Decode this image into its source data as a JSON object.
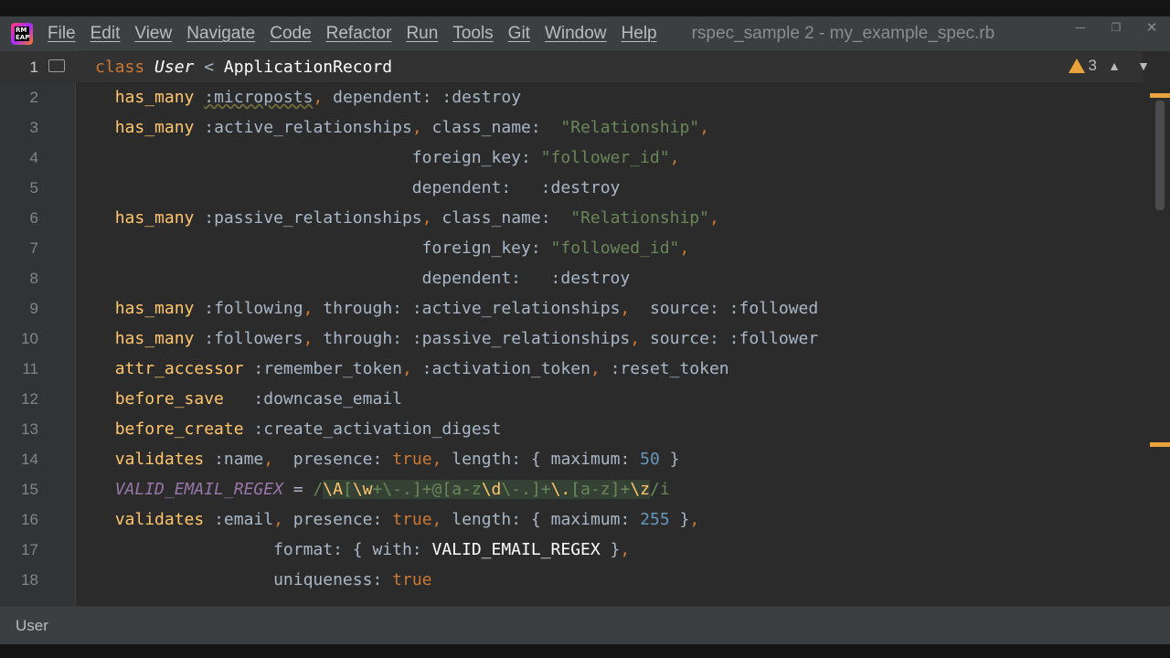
{
  "app": {
    "logo_text": "RM\nEAP",
    "window_title": "rspec_sample 2 - my_example_spec.rb"
  },
  "menu": [
    "File",
    "Edit",
    "View",
    "Navigate",
    "Code",
    "Refactor",
    "Run",
    "Tools",
    "Git",
    "Window",
    "Help"
  ],
  "editor": {
    "warnings_count": "3",
    "lines": [
      {
        "n": "1"
      },
      {
        "n": "2"
      },
      {
        "n": "3"
      },
      {
        "n": "4"
      },
      {
        "n": "5"
      },
      {
        "n": "6"
      },
      {
        "n": "7"
      },
      {
        "n": "8"
      },
      {
        "n": "9"
      },
      {
        "n": "10"
      },
      {
        "n": "11"
      },
      {
        "n": "12"
      },
      {
        "n": "13"
      },
      {
        "n": "14"
      },
      {
        "n": "15"
      },
      {
        "n": "16"
      },
      {
        "n": "17"
      },
      {
        "n": "18"
      }
    ],
    "tokens": {
      "class_kw": "class",
      "class_name": "User",
      "superclass": "ApplicationRecord",
      "has_many": "has_many",
      "microposts": ":microposts",
      "dependent": "dependent:",
      "destroy": ":destroy",
      "active_rel": ":active_relationships",
      "passive_rel": ":passive_relationships",
      "class_name_key": "class_name:",
      "relationship": "\"Relationship\"",
      "foreign_key": "foreign_key:",
      "follower_id": "\"follower_id\"",
      "followed_id": "\"followed_id\"",
      "following": ":following",
      "followers": ":followers",
      "through": "through:",
      "source": "source:",
      "followed": ":followed",
      "follower": ":follower",
      "attr_accessor": "attr_accessor",
      "remember_token": ":remember_token",
      "activation_token": ":activation_token",
      "reset_token": ":reset_token",
      "before_save": "before_save",
      "downcase_email": ":downcase_email",
      "before_create": "before_create",
      "create_activation_digest": ":create_activation_digest",
      "validates": "validates",
      "name_sym": ":name",
      "presence": "presence:",
      "true": "true",
      "length": "length:",
      "maximum": "maximum:",
      "n50": "50",
      "n255": "255",
      "valid_email": "VALID_EMAIL_REGEX",
      "email_sym": ":email",
      "format": "format:",
      "with": "with:",
      "uniqueness": "uniqueness:"
    }
  },
  "status": {
    "breadcrumb": "User"
  },
  "colors": {
    "keyword": "#cc7832",
    "method": "#ffc66d",
    "string": "#6a8759",
    "number": "#6897bb",
    "warning": "#e8a33d"
  },
  "icons": [
    "logo-icon",
    "minimize-icon",
    "maximize-icon",
    "close-icon",
    "warning-icon",
    "chevron-up-icon",
    "chevron-down-icon",
    "reader-mode-icon"
  ]
}
